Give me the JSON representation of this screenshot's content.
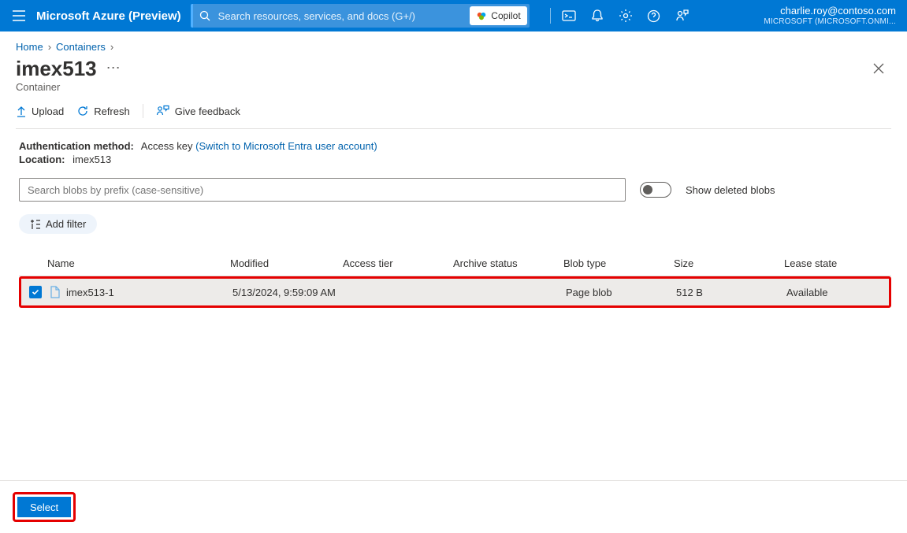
{
  "header": {
    "brand": "Microsoft Azure (Preview)",
    "search_placeholder": "Search resources, services, and docs (G+/)",
    "copilot_label": "Copilot",
    "user_email": "charlie.roy@contoso.com",
    "user_tenant": "MICROSOFT (MICROSOFT.ONMI..."
  },
  "breadcrumbs": {
    "home": "Home",
    "containers": "Containers"
  },
  "page": {
    "title": "imex513",
    "subtitle": "Container"
  },
  "toolbar": {
    "upload": "Upload",
    "refresh": "Refresh",
    "feedback": "Give feedback"
  },
  "meta": {
    "auth_label": "Authentication method:",
    "auth_value": "Access key",
    "auth_switch": "(Switch to Microsoft Entra user account)",
    "location_label": "Location:",
    "location_value": "imex513"
  },
  "filters": {
    "prefix_placeholder": "Search blobs by prefix (case-sensitive)",
    "toggle_label": "Show deleted blobs",
    "add_filter": "Add filter"
  },
  "columns": {
    "name": "Name",
    "modified": "Modified",
    "tier": "Access tier",
    "archive": "Archive status",
    "type": "Blob type",
    "size": "Size",
    "lease": "Lease state"
  },
  "rows": [
    {
      "name": "imex513-1",
      "modified": "5/13/2024, 9:59:09 AM",
      "tier": "",
      "archive": "",
      "type": "Page blob",
      "size": "512 B",
      "lease": "Available",
      "selected": true
    }
  ],
  "footer": {
    "select": "Select"
  }
}
